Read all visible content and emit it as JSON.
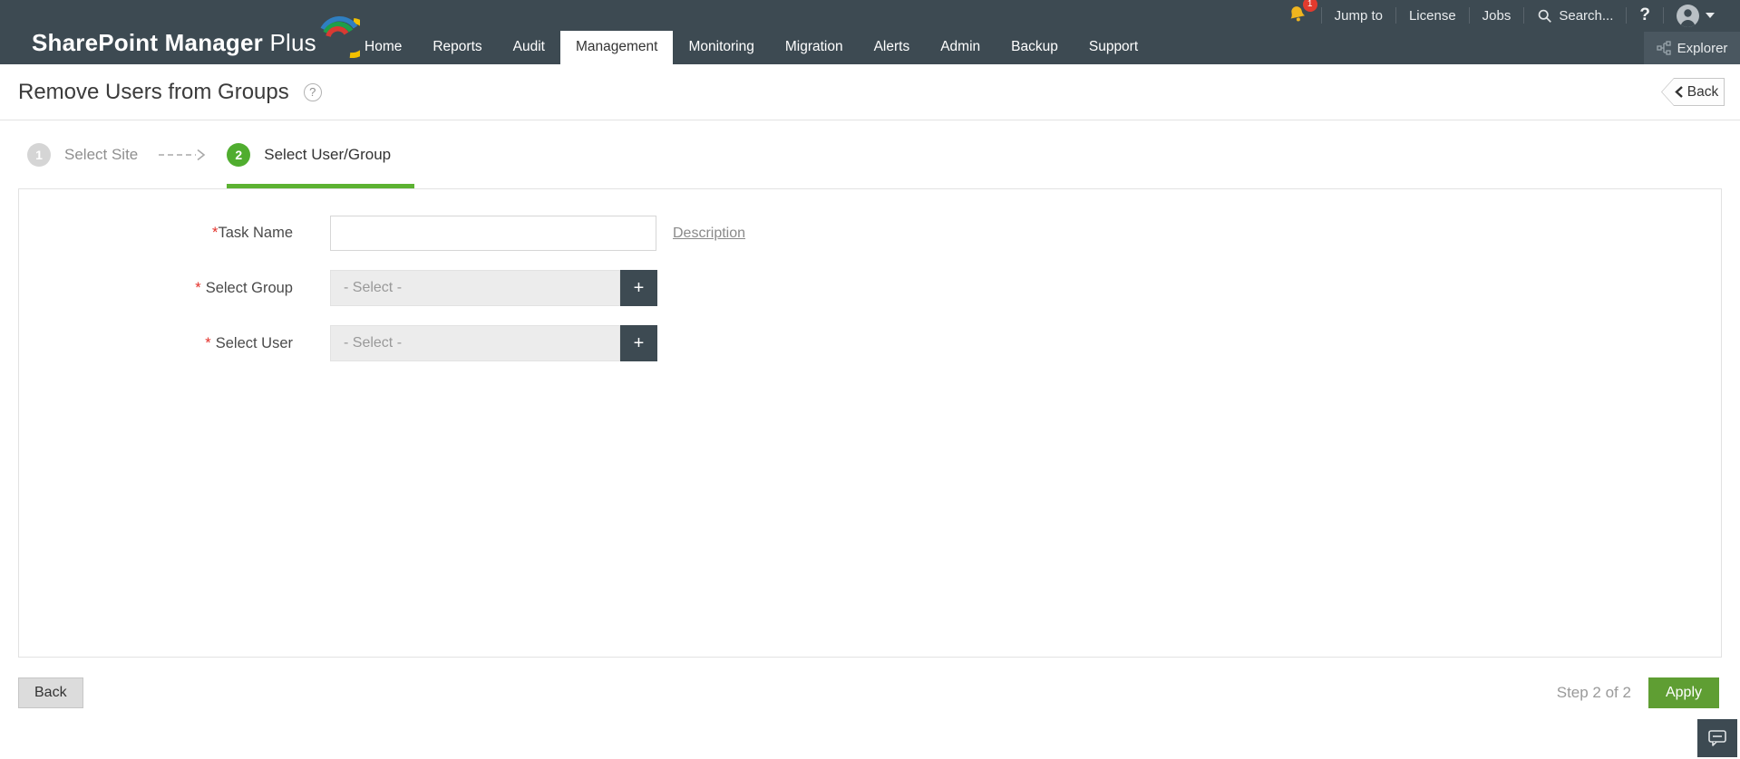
{
  "brand": {
    "name_bold": "SharePoint Manager",
    "name_thin": "Plus"
  },
  "header": {
    "nav": [
      {
        "label": "Home"
      },
      {
        "label": "Reports"
      },
      {
        "label": "Audit"
      },
      {
        "label": "Management",
        "active": true
      },
      {
        "label": "Monitoring"
      },
      {
        "label": "Migration"
      },
      {
        "label": "Alerts"
      },
      {
        "label": "Admin"
      },
      {
        "label": "Backup"
      },
      {
        "label": "Support"
      }
    ],
    "utility": {
      "notification_count": "1",
      "jump_to": "Jump to",
      "license": "License",
      "jobs": "Jobs",
      "search_label": "Search...",
      "help": "?"
    },
    "explorer_label": "Explorer"
  },
  "page": {
    "title": "Remove Users from Groups",
    "help_glyph": "?",
    "back_label": "Back"
  },
  "wizard": {
    "steps": [
      {
        "num": "1",
        "label": "Select Site"
      },
      {
        "num": "2",
        "label": "Select User/Group"
      }
    ]
  },
  "form": {
    "required_mark": "*",
    "task_name_label": "Task Name",
    "task_name_value": "",
    "description_link": "Description",
    "select_group_label": "Select Group",
    "select_user_label": "Select User",
    "select_placeholder": "- Select -",
    "add_button": "+"
  },
  "footer": {
    "back_label": "Back",
    "step_indicator": "Step 2 of 2",
    "apply_label": "Apply"
  },
  "colors": {
    "header_bg": "#3d4a52",
    "accent_green": "#5cb232",
    "apply_green": "#5f9e33",
    "required_red": "#e4322b"
  }
}
